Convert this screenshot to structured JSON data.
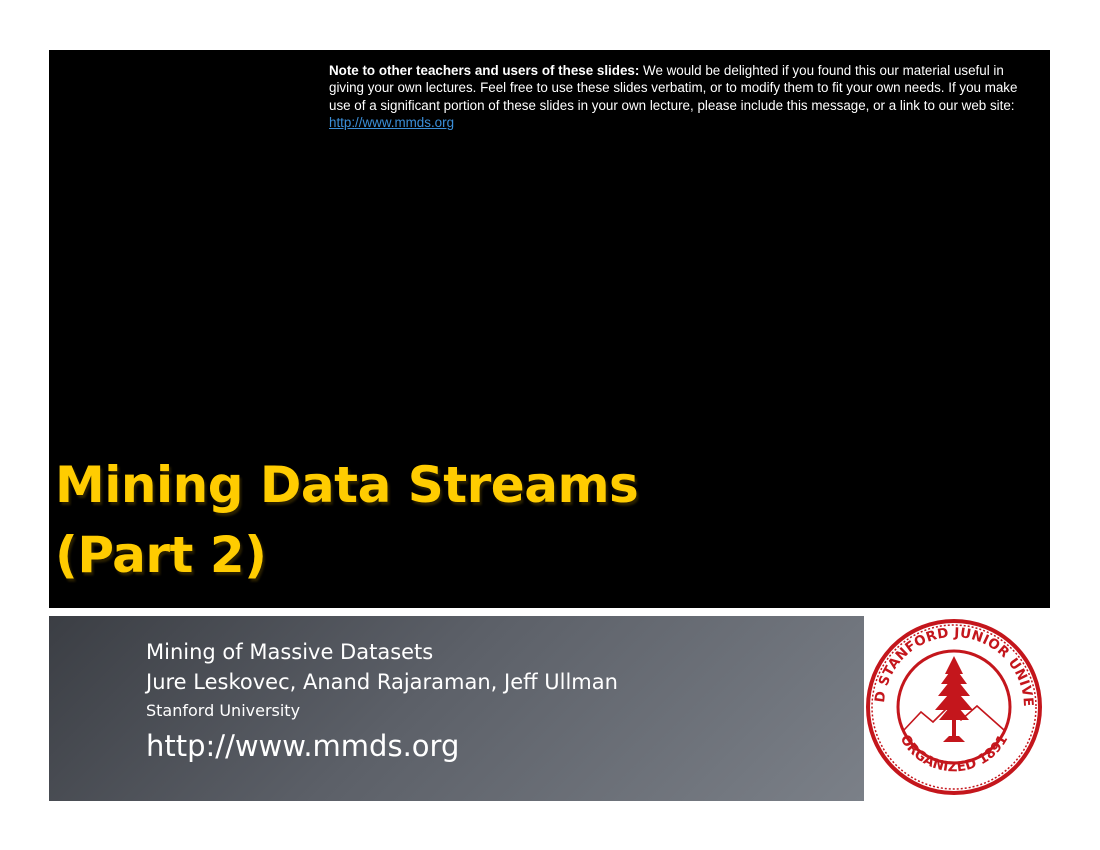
{
  "note": {
    "label": "Note to other teachers and users of these slides:",
    "body": "We would be delighted if you found this our material useful in giving your own lectures. Feel free to use these slides verbatim, or to modify them to fit your own needs. If you make use of a significant portion of these slides in your own lecture, please include this message, or a link to our web site:",
    "link": "http://www.mmds.org"
  },
  "title": {
    "line1": "Mining Data Streams",
    "line2": "(Part 2)"
  },
  "info": {
    "course": "Mining of Massive Datasets",
    "authors": "Jure Leskovec, Anand Rajaraman, Jeff Ullman",
    "affiliation": "Stanford University",
    "url": "http://www.mmds.org"
  },
  "seal": {
    "text_top": "LELAND STANFORD JUNIOR UNIVERSITY",
    "text_bottom": "ORGANIZED 1891",
    "color": "#c4161c",
    "icon": "stanford-seal-icon"
  },
  "colors": {
    "title": "#ffcc00",
    "link": "#3b8fd9",
    "slide_bg": "#000000"
  }
}
